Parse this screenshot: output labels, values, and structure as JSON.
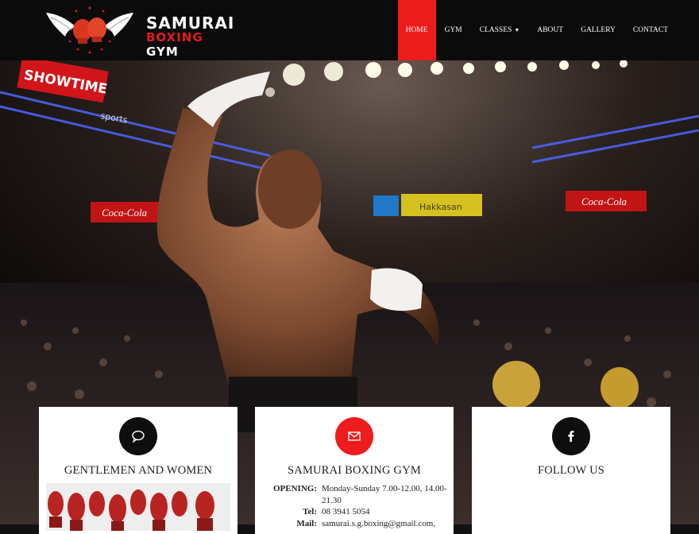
{
  "brand": {
    "line1": "SAMURAI",
    "line2_word1": "BOXING",
    "line2_word2": "GYM"
  },
  "nav": {
    "items": [
      {
        "label": "HOME",
        "active": true
      },
      {
        "label": "GYM"
      },
      {
        "label": "CLASSES",
        "has_dropdown": true
      },
      {
        "label": "ABOUT"
      },
      {
        "label": "GALLERY"
      },
      {
        "label": "CONTACT"
      }
    ]
  },
  "hero": {
    "signs": {
      "showtime": "SHOWTIME",
      "sports": "sports",
      "coke_left": "Coca-Cola",
      "hakkasan": "Hakkasan",
      "coke_right": "Coca-Cola"
    }
  },
  "cards": [
    {
      "title": "GENTLEMEN AND WOMEN",
      "icon": "speech-bubble-icon"
    },
    {
      "title": "SAMURAI BOXING GYM",
      "icon": "envelope-icon",
      "info": {
        "opening_key": "OPENING:",
        "opening_val": "Monday-Sunday 7.00-12.00, 14.00-21.30",
        "tel_key": "Tel:",
        "tel_val": "08 3941 5054",
        "mail_key": "Mail:",
        "mail_val": "samurai.s.g.boxing@gmail.com,"
      }
    },
    {
      "title": "FOLLOW US",
      "icon": "facebook-icon"
    }
  ],
  "colors": {
    "accent": "#ed1c1c",
    "header_bg": "#0b0b0b",
    "card_bg": "#ffffff"
  }
}
